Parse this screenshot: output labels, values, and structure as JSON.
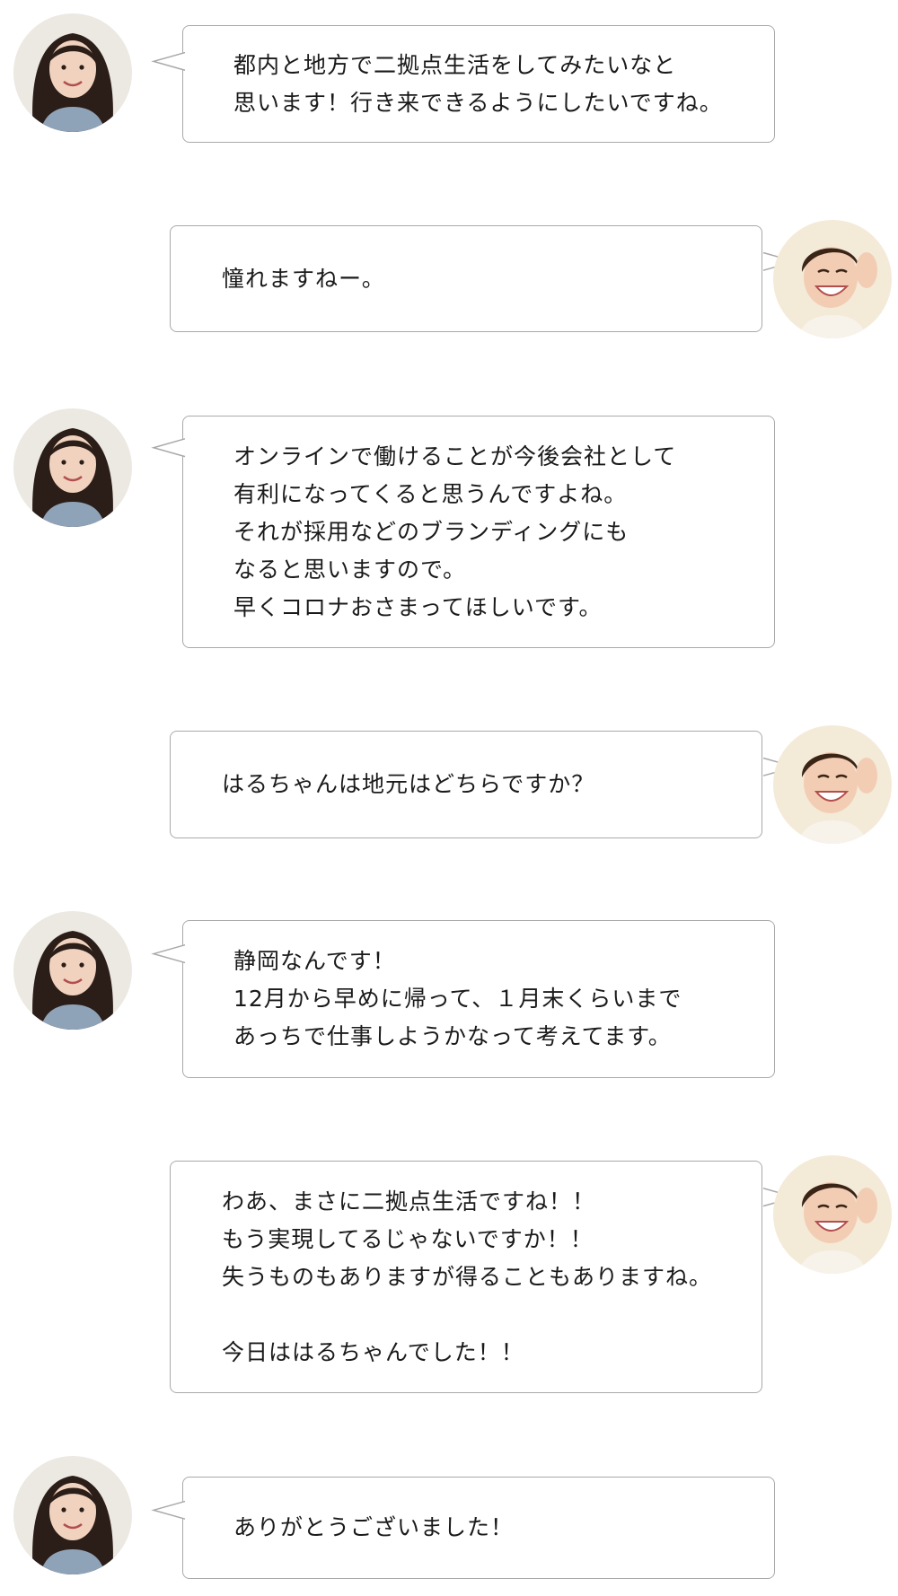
{
  "messages": [
    {
      "speaker": "haru",
      "side": "left",
      "text": "都内と地方で二拠点生活をしてみたいなと\n思います！行き来できるようにしたいですね。"
    },
    {
      "speaker": "interviewer",
      "side": "right",
      "text": "憧れますねー。"
    },
    {
      "speaker": "haru",
      "side": "left",
      "text": "オンラインで働けることが今後会社として\n有利になってくると思うんですよね。\nそれが採用などのブランディングにも\nなると思いますので。\n早くコロナおさまってほしいです。"
    },
    {
      "speaker": "interviewer",
      "side": "right",
      "text": "はるちゃんは地元はどちらですか？"
    },
    {
      "speaker": "haru",
      "side": "left",
      "text": "静岡なんです！\n12月から早めに帰って、１月末くらいまで\nあっちで仕事しようかなって考えてます。"
    },
    {
      "speaker": "interviewer",
      "side": "right",
      "text": "わあ、まさに二拠点生活ですね！！\nもう実現してるじゃないですか！！\n失うものもありますが得ることもありますね。\n\n今日ははるちゃんでした！！"
    },
    {
      "speaker": "haru",
      "side": "left",
      "text": "ありがとうございました！"
    }
  ],
  "colors": {
    "bubble_border": "#a9a9a9",
    "haru_hair": "#2b1d17",
    "haru_skin": "#f0d2bf",
    "haru_shirt": "#8fa3b8",
    "interviewer_hair": "#3a2416",
    "interviewer_skin": "#f2cdb4",
    "interviewer_bg": "#f4ead8"
  },
  "icons": {
    "haru": "avatar-woman-long-hair",
    "interviewer": "avatar-woman-short-hair"
  }
}
